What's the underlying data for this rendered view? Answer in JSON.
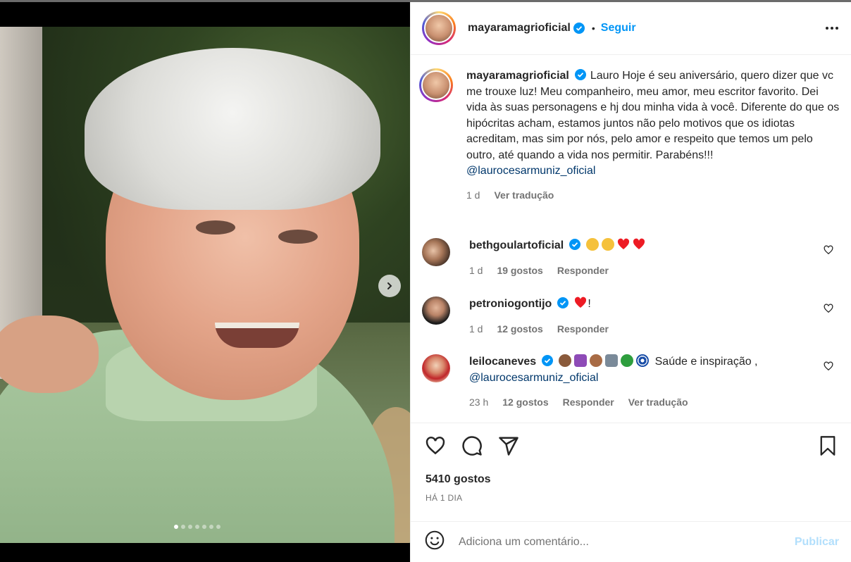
{
  "post": {
    "author": "mayaramagrioficial",
    "bullet": "•",
    "follow_label": "Seguir",
    "more_icon": "more-options-icon"
  },
  "caption": {
    "username": "mayaramagrioficial",
    "text": "Lauro Hoje é seu aniversário, quero dizer que vc me trouxe luz! Meu companheiro, meu amor, meu escritor favorito. Dei vida às suas personagens e hj dou minha vida à você. Diferente do que os hipócritas acham, estamos juntos não pelo motivos que os idiotas acreditam, mas sim por nós, pelo amor e respeito que temos um pelo outro, até quando a vida nos permitir. Parabéns!!!",
    "mention": "@laurocesarmuniz_oficial",
    "time": "1 d",
    "translate": "Ver tradução"
  },
  "comments": [
    {
      "username": "bethgoulartoficial",
      "text": "",
      "time": "1 d",
      "likes": "19 gostos",
      "reply": "Responder"
    },
    {
      "username": "petroniogontijo",
      "text": "!",
      "time": "1 d",
      "likes": "12 gostos",
      "reply": "Responder"
    },
    {
      "username": "leilocaneves",
      "text": "Saúde e inspiração ,",
      "mention": "@laurocesarmuniz_oficial",
      "time": "23 h",
      "likes": "12 gostos",
      "reply": "Responder",
      "translate": "Ver tradução"
    }
  ],
  "actions": {
    "likes_count": "5410 gostos",
    "posted": "HÁ 1 DIA"
  },
  "add_comment": {
    "placeholder": "Adiciona um comentário...",
    "publish_label": "Publicar"
  },
  "carousel": {
    "total_slides": 7,
    "active_slide": 1
  },
  "colors": {
    "link": "#00376b",
    "accent": "#0095f6",
    "publish_disabled": "#b2dffc",
    "heart_red": "#ed4956"
  }
}
